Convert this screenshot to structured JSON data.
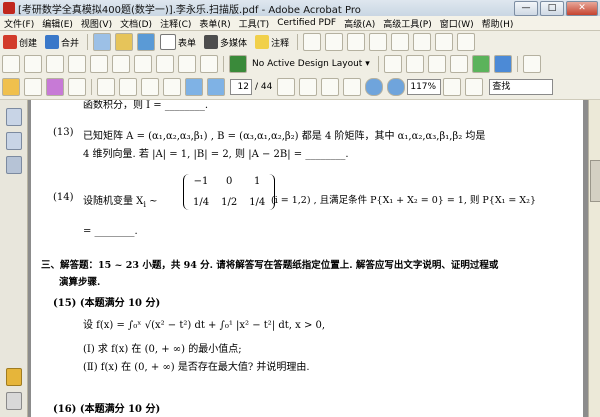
{
  "window": {
    "title": "[考研数学全真模拟400题(数学一)].李永乐.扫描版.pdf - Adobe Acrobat Pro",
    "min_label": "—",
    "max_label": "□",
    "close_label": "✕"
  },
  "menu": [
    "文件(F)",
    "编辑(E)",
    "视图(V)",
    "文档(D)",
    "注释(C)",
    "表单(R)",
    "工具(T)",
    "Certified PDF",
    "高级(A)",
    "高级工具(P)",
    "窗口(W)",
    "帮助(H)"
  ],
  "toolbar1": {
    "create": "创建",
    "combine": "合并",
    "forms": "表单",
    "multimedia": "多媒体",
    "comment": "注释"
  },
  "toolbar2": {
    "design_layout": "No Active Design Layout"
  },
  "toolbar3": {
    "page_current": "12",
    "page_total": "/ 44",
    "zoom": "117%",
    "search_placeholder": "查找"
  },
  "document": {
    "top_partial": "函数积分，则 I = ________.",
    "q13_num": "(13)",
    "q13_line1": "已知矩阵 A = (α₁,α₂,α₃,β₁) , B = (α₃,α₁,α₂,β₂) 都是 4 阶矩阵，其中 α₁,α₂,α₃,β₁,β₂ 均是",
    "q13_line2": "4 维列向量. 若 |A| = 1, |B| = 2, 则 |A − 2B| = ________.",
    "q14_num": "(14)",
    "q14_prefix": "设随机变量 X",
    "q14_sub": "i",
    "q14_tilde": "~",
    "q14_row1": [
      "−1",
      "0",
      "1"
    ],
    "q14_row2": [
      "1/4",
      "1/2",
      "1/4"
    ],
    "q14_suffix": "(i = 1,2) , 且满足条件 P{X₁ + X₂ = 0} = 1, 则 P{X₁ = X₂}",
    "q14_blank": "= ________.",
    "section3_line1": "三、解答题：15 ~ 23 小题，共 94 分. 请将解答写在答题纸指定位置上. 解答应写出文字说明、证明过程或",
    "section3_line2": "演算步骤.",
    "q15_header": "(15)  (本题满分 10 分)",
    "q15_formula": "设 f(x) = ∫₀ˣ √(x² − t²) dt + ∫₀¹ |x² − t²| dt, x > 0,",
    "q15_part1": "(Ⅰ)   求 f(x) 在 (0, + ∞) 的最小值点;",
    "q15_part2": "(Ⅱ)   f(x) 在 (0, + ∞) 是否存在最大值? 并说明理由.",
    "q16_header": "(16)  (本题满分 10 分)"
  },
  "colors": {
    "accent_blue": "#2a66c2",
    "close_red": "#c5432f"
  }
}
